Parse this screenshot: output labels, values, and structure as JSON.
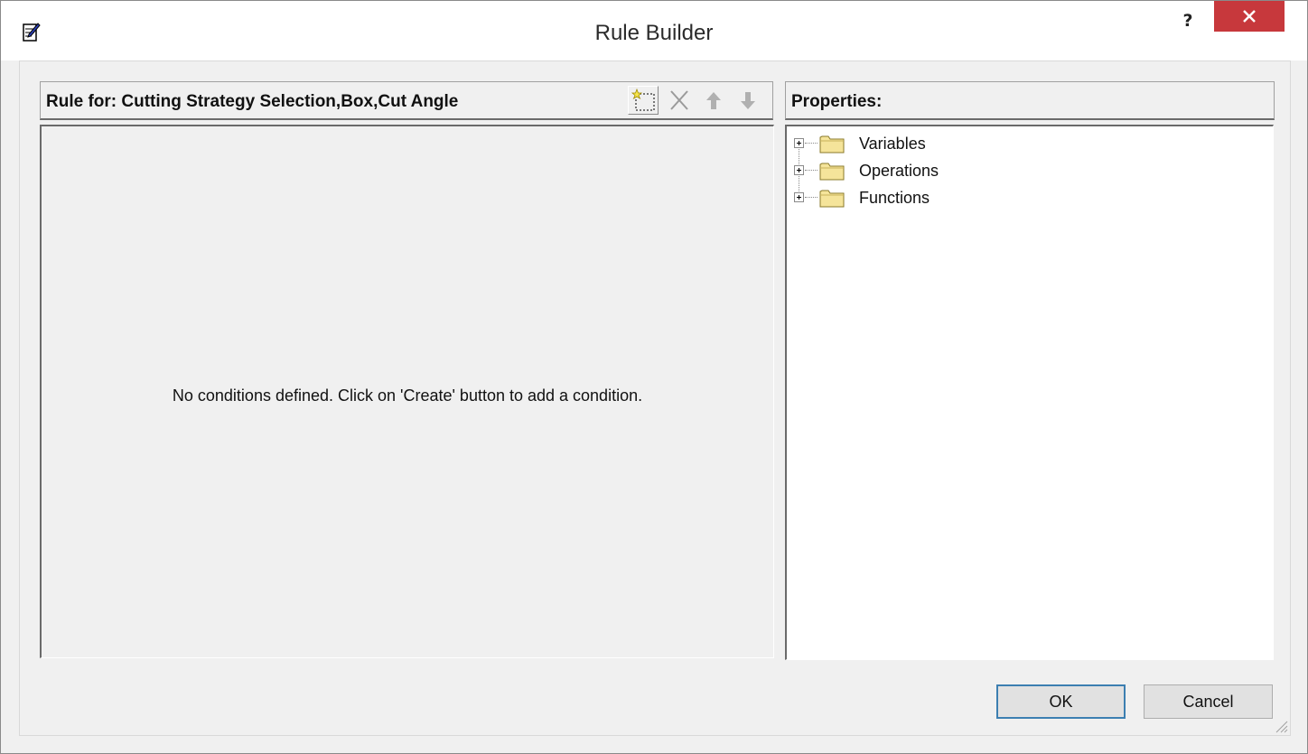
{
  "window": {
    "title": "Rule Builder",
    "help_label": "?",
    "icons": {
      "app": "rule-edit-icon",
      "close": "close-icon"
    },
    "colors": {
      "close_button": "#c7383c",
      "default_button_border": "#3c7fb1"
    }
  },
  "rule_panel": {
    "header": "Rule for: Cutting Strategy Selection,Box,Cut Angle",
    "toolbar": [
      {
        "name": "create",
        "icon": "new-condition-icon",
        "enabled": true
      },
      {
        "name": "delete",
        "icon": "delete-icon",
        "enabled": false
      },
      {
        "name": "move-up",
        "icon": "arrow-up-icon",
        "enabled": false
      },
      {
        "name": "move-down",
        "icon": "arrow-down-icon",
        "enabled": false
      }
    ],
    "empty_message": "No conditions defined.  Click on 'Create' button to add a condition."
  },
  "properties_panel": {
    "header": "Properties:",
    "tree": [
      {
        "label": "Variables",
        "icon": "folder-icon",
        "expanded": false
      },
      {
        "label": "Operations",
        "icon": "folder-icon",
        "expanded": false
      },
      {
        "label": "Functions",
        "icon": "folder-icon",
        "expanded": false
      }
    ]
  },
  "buttons": {
    "ok": "OK",
    "cancel": "Cancel"
  }
}
